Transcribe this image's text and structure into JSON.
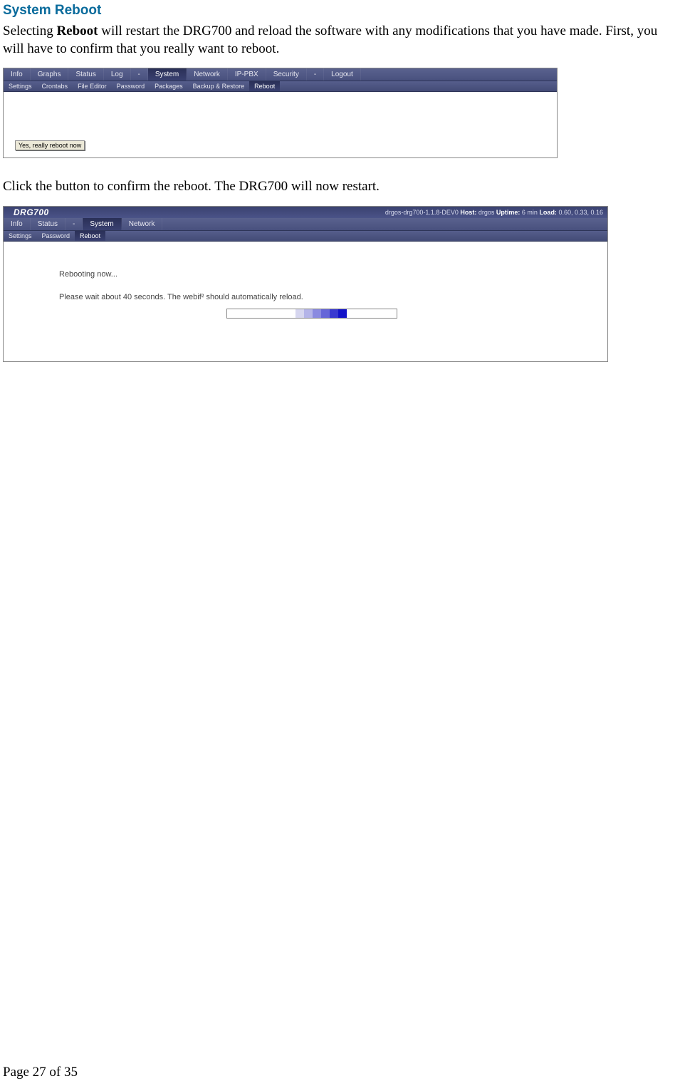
{
  "heading": "System Reboot",
  "para1_pre": "Selecting ",
  "para1_bold": "Reboot",
  "para1_post": " will restart the DRG700 and reload the software with any modifications that you have made.  First, you will have to confirm that you really want to reboot.",
  "shot1": {
    "nav": [
      "Info",
      "Graphs",
      "Status",
      "Log",
      "-",
      "System",
      "Network",
      "IP-PBX",
      "Security",
      "-",
      "Logout"
    ],
    "nav_active_index": 5,
    "subnav": [
      "Settings",
      "Crontabs",
      "File Editor",
      "Password",
      "Packages",
      "Backup & Restore",
      "Reboot"
    ],
    "subnav_active_index": 6,
    "button_label": "Yes, really reboot now"
  },
  "para2": "Click the button to confirm the reboot. The DRG700 will now restart.",
  "shot2": {
    "brand": "DRG700",
    "status_html": "drgos-drg700-1.1.8-DEV0 Host: drgos Uptime: 6 min Load: 0.60, 0.33, 0.16",
    "status_parts": {
      "ver": "drgos-drg700-1.1.8-DEV0",
      "host_label": "Host:",
      "host": " drgos ",
      "uptime_label": "Uptime:",
      "uptime": " 6 min ",
      "load_label": "Load:",
      "load": " 0.60, 0.33, 0.16"
    },
    "nav": [
      "Info",
      "Status",
      "-",
      "System",
      "Network"
    ],
    "nav_active_index": 3,
    "subnav": [
      "Settings",
      "Password",
      "Reboot"
    ],
    "subnav_active_index": 2,
    "msg1": "Rebooting now...",
    "msg2": "Please wait about 40 seconds. The webif² should automatically reload."
  },
  "footer": "Page 27 of 35"
}
